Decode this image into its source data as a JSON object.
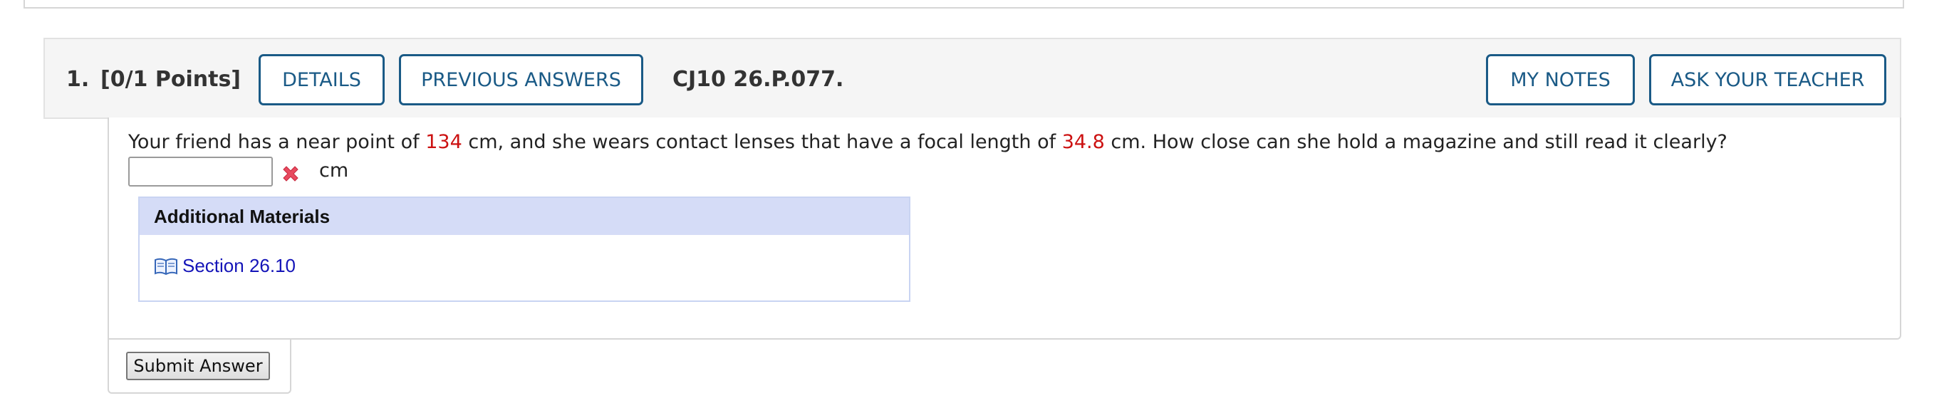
{
  "question": {
    "number": "1.",
    "points": "[0/1 Points]",
    "code": "CJ10 26.P.077.",
    "buttons": {
      "details": "DETAILS",
      "previous_answers": "PREVIOUS ANSWERS",
      "my_notes": "MY NOTES",
      "ask_teacher": "ASK YOUR TEACHER"
    },
    "text": {
      "part1": "Your friend has a near point of ",
      "near_point": "134",
      "part2": " cm, and she wears contact lenses that have a focal length of ",
      "focal_length": "34.8",
      "part3": " cm. How close can she hold a magazine and still read it clearly?"
    },
    "answer": {
      "value": "",
      "unit": "cm",
      "status_icon": "wrong-x-icon"
    }
  },
  "additional_materials": {
    "title": "Additional Materials",
    "items": [
      {
        "label": "Section 26.10",
        "icon": "book-icon"
      }
    ]
  },
  "submit": {
    "label": "Submit Answer"
  },
  "colors": {
    "accent_blue": "#1a5a86",
    "given_value_red": "#cc1111",
    "link_blue": "#1414b8",
    "materials_header": "#d5dcf7",
    "error_red": "#e84a5f"
  }
}
